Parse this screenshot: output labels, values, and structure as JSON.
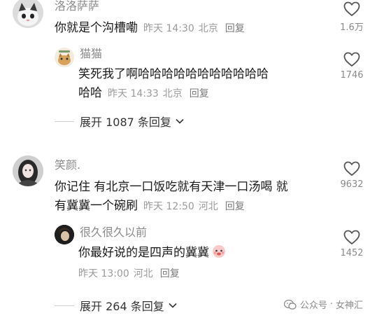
{
  "comments": [
    {
      "user": "洛洛萨萨",
      "text": "你就是个沟槽嘞",
      "time": "昨天 14:30",
      "location": "北京",
      "reply_label": "回复",
      "likes": "1.6万",
      "avatar_icon": "cat-avatar-icon"
    },
    {
      "user": "猫猫",
      "text_line1": "笑死我了啊哈哈哈哈哈哈哈哈哈哈哈",
      "text_line2": "哈哈",
      "time": "昨天 14:33",
      "location": "北京",
      "reply_label": "回复",
      "likes": "1746",
      "avatar_icon": "cat-illustration-avatar-icon"
    },
    {
      "user": "笑颜.",
      "text_line1": "你记住 有北京一口饭吃就有天津一口汤喝 就",
      "text_line2": "有冀冀一个碗刷",
      "time": "昨天 12:50",
      "location": "河北",
      "reply_label": "回复",
      "likes": "9632",
      "avatar_icon": "girl-avatar-icon"
    },
    {
      "user": "很久很久以前",
      "text": "你最好说的是四声的冀冀",
      "time": "昨天 13:00",
      "location": "河北",
      "reply_label": "回复",
      "likes": "1452",
      "avatar_icon": "dark-avatar-icon"
    }
  ],
  "expand_1": "展开 1087 条回复",
  "expand_2": "展开 264 条回复",
  "watermark": {
    "brand": "公众号",
    "separator": "·",
    "account": "女神汇"
  },
  "colors": {
    "username": "#8a8a8a",
    "meta": "#9a9a9a",
    "text": "#1a1a1a",
    "heart_outline": "#555555"
  }
}
